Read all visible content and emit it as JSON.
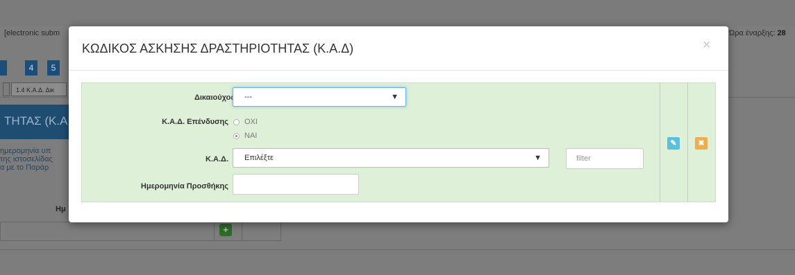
{
  "background": {
    "header_left_text": "[electronic subm",
    "header_right_label": "Ώρα έναρξης:",
    "header_right_value": "28",
    "steps": [
      "4",
      "5"
    ],
    "tab_label": "1.4 Κ.Α.Δ. Δικ",
    "section_heading": "ΤΗΤΑΣ (Κ.Α",
    "description_lines": [
      "ημερομηνία υπ",
      "της ιστοσελίδας",
      "α με το Παράρ"
    ],
    "table_header": "Ημ",
    "add_button_icon": "plus-circle-icon"
  },
  "modal": {
    "title": "ΚΩΔΙΚΟΣ ΑΣΚΗΣΗΣ ΔΡΑΣΤΗΡΙΟΤΗΤΑΣ (Κ.Α.Δ)",
    "close_symbol": "×",
    "form": {
      "beneficiary_label": "Δικαιούχος",
      "beneficiary_value": "---",
      "investment_kad_label": "Κ.Α.Δ. Επένδυσης",
      "radio_options": [
        {
          "label": "ΟΧΙ",
          "checked": false
        },
        {
          "label": "ΝΑΙ",
          "checked": true
        }
      ],
      "kad_label": "Κ.Α.Δ.",
      "kad_value": "Επιλέξτε",
      "filter_placeholder": "filter",
      "date_label": "Ημερομηνία Προσθήκης",
      "date_value": ""
    },
    "actions": {
      "edit_icon": "edit-icon",
      "cancel_icon": "close-icon"
    }
  },
  "colors": {
    "panel_bg": "#dff0d8",
    "edit_button": "#5bc0de",
    "cancel_button": "#f0ad4e",
    "bg_step": "#1b4f7a"
  }
}
